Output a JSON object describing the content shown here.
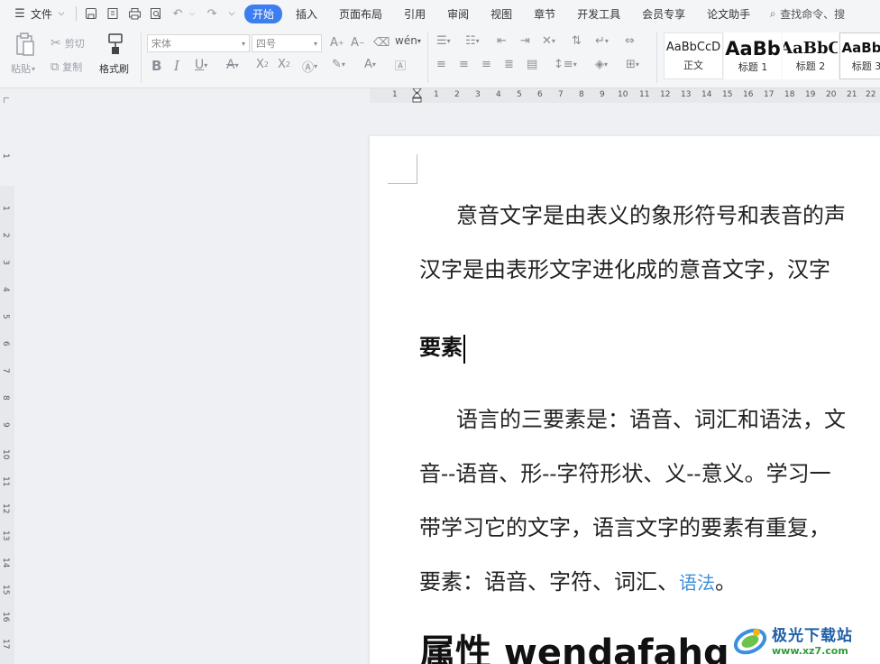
{
  "menubar": {
    "file_label": "文件",
    "tabs": [
      {
        "label": "开始",
        "active": true
      },
      {
        "label": "插入"
      },
      {
        "label": "页面布局"
      },
      {
        "label": "引用"
      },
      {
        "label": "审阅"
      },
      {
        "label": "视图"
      },
      {
        "label": "章节"
      },
      {
        "label": "开发工具"
      },
      {
        "label": "会员专享"
      },
      {
        "label": "论文助手"
      }
    ],
    "search_label": "查找命令、搜"
  },
  "ribbon": {
    "cut_label": "剪切",
    "paste_label": "粘贴",
    "copy_label": "复制",
    "format_painter_label": "格式刷",
    "font_name": "宋体",
    "font_size": "四号",
    "styles": [
      {
        "preview": "AaBbCcD",
        "label": "正文"
      },
      {
        "preview": "AaBb",
        "label": "标题 1"
      },
      {
        "preview": "AaBbC",
        "label": "标题 2"
      },
      {
        "preview": "AaBbC",
        "label": "标题 3"
      }
    ]
  },
  "ruler": {
    "h_numbers": [
      "1",
      "1",
      "2",
      "3",
      "4",
      "5",
      "6",
      "7",
      "8",
      "9",
      "10",
      "11",
      "12",
      "13",
      "14",
      "15",
      "16",
      "17",
      "18",
      "19",
      "20",
      "21",
      "22"
    ],
    "v_numbers": [
      "1",
      "1",
      "2",
      "3",
      "4",
      "5",
      "6",
      "7",
      "8",
      "9",
      "10",
      "11",
      "12",
      "13",
      "14",
      "15",
      "16",
      "17"
    ]
  },
  "document": {
    "para1_line1": "意音文字是由表义的象形符号和表音的声",
    "para1_line2": "汉字是由表形文字进化成的意音文字，汉字",
    "heading1": "要素",
    "para2_line1": "语言的三要素是：语音、词汇和语法，文",
    "para2_line2": "音--语音、形--字符形状、义--意义。学习一",
    "para2_line3": "带学习它的文字，语言文字的要素有重复，",
    "para2_line4_prefix": "要素：语音、字符、词汇、",
    "para2_line4_link": "语法",
    "para2_line4_suffix": "。",
    "heading2": "属性 wendafahg"
  },
  "watermark": {
    "title": "极光下载站",
    "url": "www.xz7.com"
  },
  "colors": {
    "accent": "#3c7ef0",
    "link": "#3f8fd8"
  }
}
